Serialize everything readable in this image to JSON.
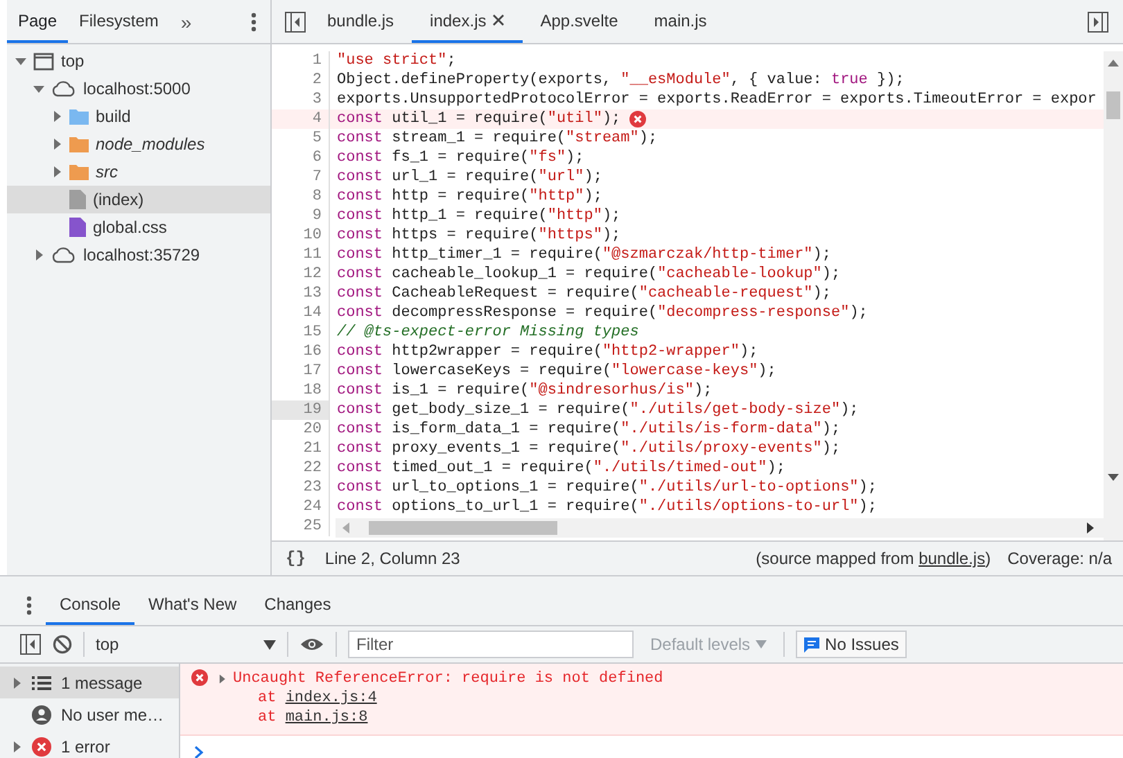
{
  "navigator": {
    "tabs": [
      {
        "label": "Page",
        "selected": true
      },
      {
        "label": "Filesystem",
        "selected": false
      }
    ],
    "more": "»",
    "tree": [
      {
        "label": "top",
        "kind": "frame",
        "expanded": true,
        "selected": false,
        "children": [
          {
            "label": "localhost:5000",
            "kind": "origin",
            "expanded": true,
            "selected": false,
            "children": [
              {
                "label": "build",
                "kind": "folder",
                "color": "#7ab8f0",
                "italic": false,
                "expanded": false,
                "selected": false
              },
              {
                "label": "node_modules",
                "kind": "folder",
                "color": "#ee9b4f",
                "italic": true,
                "expanded": false,
                "selected": false
              },
              {
                "label": "src",
                "kind": "folder",
                "color": "#ee9b4f",
                "italic": true,
                "expanded": false,
                "selected": false
              },
              {
                "label": "(index)",
                "kind": "file",
                "color": "#9e9e9e",
                "italic": false,
                "selected": true
              },
              {
                "label": "global.css",
                "kind": "file",
                "color": "#8654cc",
                "italic": false,
                "selected": false
              }
            ]
          },
          {
            "label": "localhost:35729",
            "kind": "origin",
            "expanded": false,
            "selected": false
          }
        ]
      }
    ]
  },
  "editor": {
    "tabs": [
      {
        "label": "bundle.js",
        "selected": false,
        "closable": false
      },
      {
        "label": "index.js",
        "selected": true,
        "closable": true
      },
      {
        "label": "App.svelte",
        "selected": false,
        "closable": false
      },
      {
        "label": "main.js",
        "selected": false,
        "closable": false
      }
    ],
    "lines": [
      {
        "number": "1",
        "error": false,
        "current": false,
        "tokens": [
          {
            "kind": "str",
            "text": "\"use strict\""
          },
          {
            "kind": "txt",
            "text": ";"
          }
        ]
      },
      {
        "number": "2",
        "error": false,
        "current": false,
        "tokens": [
          {
            "kind": "txt",
            "text": "Object.defineProperty(exports, "
          },
          {
            "kind": "str",
            "text": "\"__esModule\""
          },
          {
            "kind": "txt",
            "text": ", { value: "
          },
          {
            "kind": "kw",
            "text": "true"
          },
          {
            "kind": "txt",
            "text": " });"
          }
        ]
      },
      {
        "number": "3",
        "error": false,
        "current": false,
        "tokens": [
          {
            "kind": "txt",
            "text": "exports.UnsupportedProtocolError = exports.ReadError = exports.TimeoutError = expor"
          }
        ]
      },
      {
        "number": "4",
        "error": true,
        "current": false,
        "tokens": [
          {
            "kind": "kw",
            "text": "const"
          },
          {
            "kind": "txt",
            "text": " util_1 = require("
          },
          {
            "kind": "str",
            "text": "\"util\""
          },
          {
            "kind": "txt",
            "text": ");"
          }
        ]
      },
      {
        "number": "5",
        "error": false,
        "current": false,
        "tokens": [
          {
            "kind": "kw",
            "text": "const"
          },
          {
            "kind": "txt",
            "text": " stream_1 = require("
          },
          {
            "kind": "str",
            "text": "\"stream\""
          },
          {
            "kind": "txt",
            "text": ");"
          }
        ]
      },
      {
        "number": "6",
        "error": false,
        "current": false,
        "tokens": [
          {
            "kind": "kw",
            "text": "const"
          },
          {
            "kind": "txt",
            "text": " fs_1 = require("
          },
          {
            "kind": "str",
            "text": "\"fs\""
          },
          {
            "kind": "txt",
            "text": ");"
          }
        ]
      },
      {
        "number": "7",
        "error": false,
        "current": false,
        "tokens": [
          {
            "kind": "kw",
            "text": "const"
          },
          {
            "kind": "txt",
            "text": " url_1 = require("
          },
          {
            "kind": "str",
            "text": "\"url\""
          },
          {
            "kind": "txt",
            "text": ");"
          }
        ]
      },
      {
        "number": "8",
        "error": false,
        "current": false,
        "tokens": [
          {
            "kind": "kw",
            "text": "const"
          },
          {
            "kind": "txt",
            "text": " http = require("
          },
          {
            "kind": "str",
            "text": "\"http\""
          },
          {
            "kind": "txt",
            "text": ");"
          }
        ]
      },
      {
        "number": "9",
        "error": false,
        "current": false,
        "tokens": [
          {
            "kind": "kw",
            "text": "const"
          },
          {
            "kind": "txt",
            "text": " http_1 = require("
          },
          {
            "kind": "str",
            "text": "\"http\""
          },
          {
            "kind": "txt",
            "text": ");"
          }
        ]
      },
      {
        "number": "10",
        "error": false,
        "current": false,
        "tokens": [
          {
            "kind": "kw",
            "text": "const"
          },
          {
            "kind": "txt",
            "text": " https = require("
          },
          {
            "kind": "str",
            "text": "\"https\""
          },
          {
            "kind": "txt",
            "text": ");"
          }
        ]
      },
      {
        "number": "11",
        "error": false,
        "current": false,
        "tokens": [
          {
            "kind": "kw",
            "text": "const"
          },
          {
            "kind": "txt",
            "text": " http_timer_1 = require("
          },
          {
            "kind": "str",
            "text": "\"@szmarczak/http-timer\""
          },
          {
            "kind": "txt",
            "text": ");"
          }
        ]
      },
      {
        "number": "12",
        "error": false,
        "current": false,
        "tokens": [
          {
            "kind": "kw",
            "text": "const"
          },
          {
            "kind": "txt",
            "text": " cacheable_lookup_1 = require("
          },
          {
            "kind": "str",
            "text": "\"cacheable-lookup\""
          },
          {
            "kind": "txt",
            "text": ");"
          }
        ]
      },
      {
        "number": "13",
        "error": false,
        "current": false,
        "tokens": [
          {
            "kind": "kw",
            "text": "const"
          },
          {
            "kind": "txt",
            "text": " CacheableRequest = require("
          },
          {
            "kind": "str",
            "text": "\"cacheable-request\""
          },
          {
            "kind": "txt",
            "text": ");"
          }
        ]
      },
      {
        "number": "14",
        "error": false,
        "current": false,
        "tokens": [
          {
            "kind": "kw",
            "text": "const"
          },
          {
            "kind": "txt",
            "text": " decompressResponse = require("
          },
          {
            "kind": "str",
            "text": "\"decompress-response\""
          },
          {
            "kind": "txt",
            "text": ");"
          }
        ]
      },
      {
        "number": "15",
        "error": false,
        "current": false,
        "tokens": [
          {
            "kind": "com",
            "text": "// @ts-expect-error Missing types"
          }
        ]
      },
      {
        "number": "16",
        "error": false,
        "current": false,
        "tokens": [
          {
            "kind": "kw",
            "text": "const"
          },
          {
            "kind": "txt",
            "text": " http2wrapper = require("
          },
          {
            "kind": "str",
            "text": "\"http2-wrapper\""
          },
          {
            "kind": "txt",
            "text": ");"
          }
        ]
      },
      {
        "number": "17",
        "error": false,
        "current": false,
        "tokens": [
          {
            "kind": "kw",
            "text": "const"
          },
          {
            "kind": "txt",
            "text": " lowercaseKeys = require("
          },
          {
            "kind": "str",
            "text": "\"lowercase-keys\""
          },
          {
            "kind": "txt",
            "text": ");"
          }
        ]
      },
      {
        "number": "18",
        "error": false,
        "current": false,
        "tokens": [
          {
            "kind": "kw",
            "text": "const"
          },
          {
            "kind": "txt",
            "text": " is_1 = require("
          },
          {
            "kind": "str",
            "text": "\"@sindresorhus/is\""
          },
          {
            "kind": "txt",
            "text": ");"
          }
        ]
      },
      {
        "number": "19",
        "error": false,
        "current": true,
        "tokens": [
          {
            "kind": "kw",
            "text": "const"
          },
          {
            "kind": "txt",
            "text": " get_body_size_1 = require("
          },
          {
            "kind": "str",
            "text": "\"./utils/get-body-size\""
          },
          {
            "kind": "txt",
            "text": ");"
          }
        ]
      },
      {
        "number": "20",
        "error": false,
        "current": false,
        "tokens": [
          {
            "kind": "kw",
            "text": "const"
          },
          {
            "kind": "txt",
            "text": " is_form_data_1 = require("
          },
          {
            "kind": "str",
            "text": "\"./utils/is-form-data\""
          },
          {
            "kind": "txt",
            "text": ");"
          }
        ]
      },
      {
        "number": "21",
        "error": false,
        "current": false,
        "tokens": [
          {
            "kind": "kw",
            "text": "const"
          },
          {
            "kind": "txt",
            "text": " proxy_events_1 = require("
          },
          {
            "kind": "str",
            "text": "\"./utils/proxy-events\""
          },
          {
            "kind": "txt",
            "text": ");"
          }
        ]
      },
      {
        "number": "22",
        "error": false,
        "current": false,
        "tokens": [
          {
            "kind": "kw",
            "text": "const"
          },
          {
            "kind": "txt",
            "text": " timed_out_1 = require("
          },
          {
            "kind": "str",
            "text": "\"./utils/timed-out\""
          },
          {
            "kind": "txt",
            "text": ");"
          }
        ]
      },
      {
        "number": "23",
        "error": false,
        "current": false,
        "tokens": [
          {
            "kind": "kw",
            "text": "const"
          },
          {
            "kind": "txt",
            "text": " url_to_options_1 = require("
          },
          {
            "kind": "str",
            "text": "\"./utils/url-to-options\""
          },
          {
            "kind": "txt",
            "text": ");"
          }
        ]
      },
      {
        "number": "24",
        "error": false,
        "current": false,
        "tokens": [
          {
            "kind": "kw",
            "text": "const"
          },
          {
            "kind": "txt",
            "text": " options_to_url_1 = require("
          },
          {
            "kind": "str",
            "text": "\"./utils/options-to-url\""
          },
          {
            "kind": "txt",
            "text": ");"
          }
        ]
      },
      {
        "number": "25",
        "error": false,
        "current": false
      }
    ],
    "status": {
      "format_button": "{}",
      "cursor": "Line 2, Column 23",
      "source_prefix": "(source mapped from ",
      "source_link": "bundle.js",
      "source_suffix": ")",
      "coverage": "Coverage: n/a"
    }
  },
  "console": {
    "tabs": [
      {
        "label": "Console",
        "selected": true
      },
      {
        "label": "What's New",
        "selected": false
      },
      {
        "label": "Changes",
        "selected": false
      }
    ],
    "context": "top",
    "filter": {
      "placeholder": "Filter"
    },
    "levels": "Default levels",
    "issues": "No Issues",
    "sidebar": [
      {
        "label": "1 message",
        "kind": "messages",
        "expandable": true,
        "selected": true
      },
      {
        "label": "No user me…",
        "kind": "user",
        "expandable": false,
        "selected": false
      },
      {
        "label": "1 error",
        "kind": "errors",
        "expandable": true,
        "selected": false
      }
    ],
    "messages": [
      {
        "kind": "error",
        "text": "Uncaught ReferenceError: require is not defined",
        "stack": [
          {
            "prefix": "at ",
            "link": "index.js:4"
          },
          {
            "prefix": "at ",
            "link": "main.js:8"
          }
        ]
      }
    ]
  }
}
